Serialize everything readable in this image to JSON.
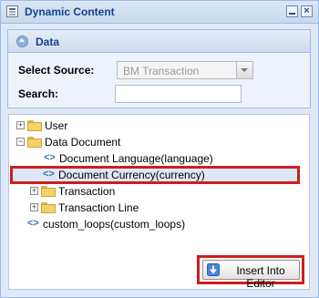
{
  "window": {
    "title": "Dynamic Content",
    "icon": "document-list-icon"
  },
  "panel": {
    "title": "Data",
    "select_source_label": "Select Source:",
    "select_source_value": "BM Transaction",
    "search_label": "Search:",
    "search_value": ""
  },
  "tree": {
    "nodes": [
      {
        "label": "User",
        "type": "folder",
        "expanded": false
      },
      {
        "label": "Data Document",
        "type": "folder",
        "expanded": true
      },
      {
        "label": "Document Language(language)",
        "type": "field"
      },
      {
        "label": "Document Currency(currency)",
        "type": "field",
        "selected": true
      },
      {
        "label": "Transaction",
        "type": "folder",
        "expanded": false
      },
      {
        "label": "Transaction Line",
        "type": "folder",
        "expanded": false
      },
      {
        "label": "custom_loops(custom_loops)",
        "type": "field"
      }
    ]
  },
  "insert_button": {
    "label": "Insert Into Editor",
    "icon": "arrow-down-icon"
  },
  "colors": {
    "highlight_border": "#cc1f1f",
    "header_text": "#15428b",
    "window_border": "#99bbe8"
  }
}
